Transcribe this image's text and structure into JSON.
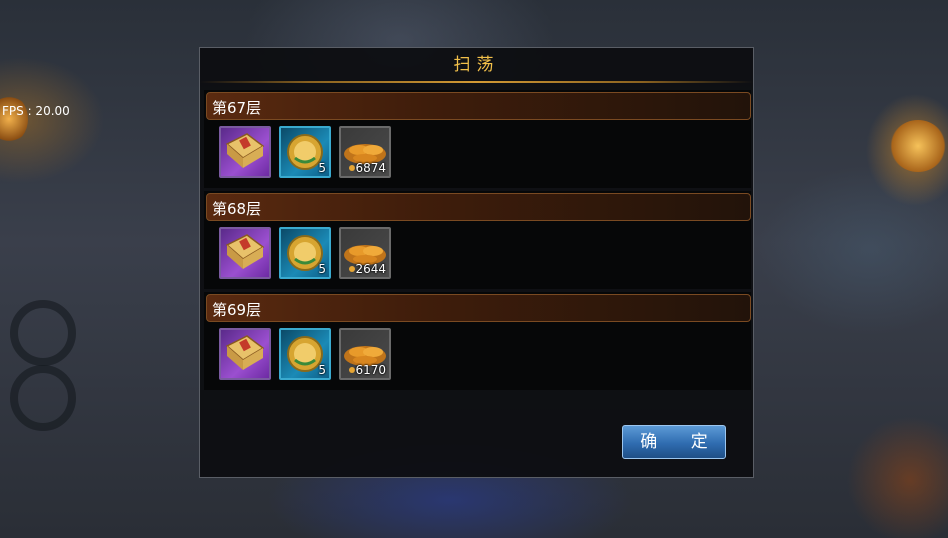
{
  "hud": {
    "fps_label": "FPS : 20.00"
  },
  "dialog": {
    "title": "扫荡",
    "confirm_label": "确 定",
    "floors": [
      {
        "label": "第67层",
        "items": [
          {
            "icon": "book-icon",
            "qty": ""
          },
          {
            "icon": "medal-icon",
            "qty": "5"
          },
          {
            "icon": "gold-coins-icon",
            "qty": "6874"
          }
        ]
      },
      {
        "label": "第68层",
        "items": [
          {
            "icon": "book-icon",
            "qty": ""
          },
          {
            "icon": "medal-icon",
            "qty": "5"
          },
          {
            "icon": "gold-coins-icon",
            "qty": "2644"
          }
        ]
      },
      {
        "label": "第69层",
        "items": [
          {
            "icon": "book-icon",
            "qty": ""
          },
          {
            "icon": "medal-icon",
            "qty": "5"
          },
          {
            "icon": "gold-coins-icon",
            "qty": "6170"
          }
        ]
      }
    ]
  },
  "colors": {
    "title": "#f2c04a",
    "button": "#2f6cb0",
    "header": "#5a2a10"
  }
}
